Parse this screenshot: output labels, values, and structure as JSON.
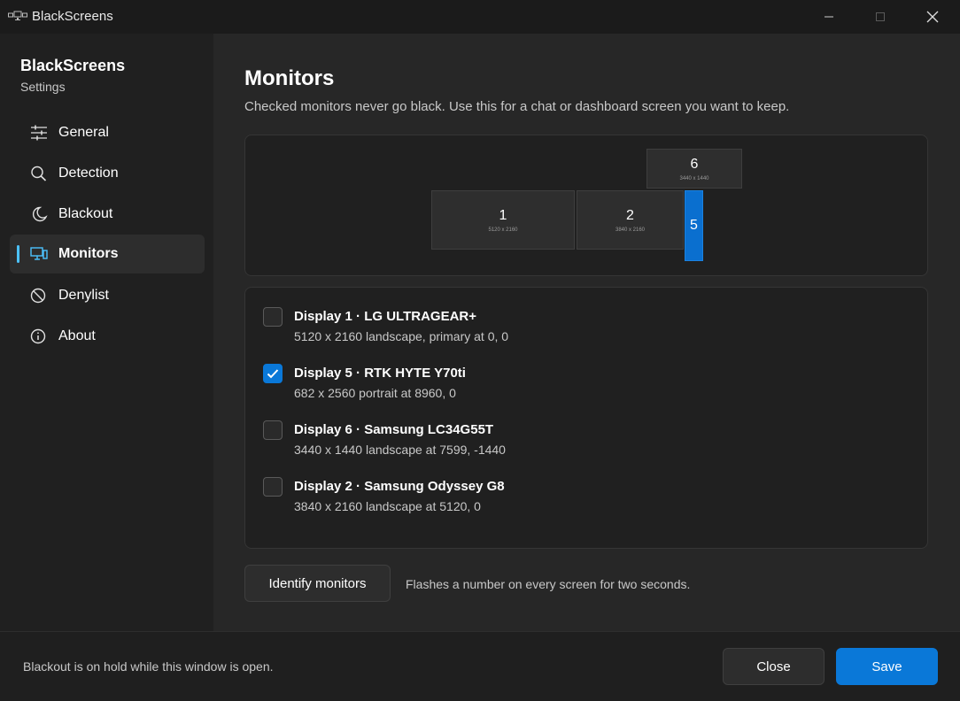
{
  "window": {
    "title": "BlackScreens"
  },
  "sidebar": {
    "brand_title": "BlackScreens",
    "brand_subtitle": "Settings",
    "items": [
      {
        "label": "General",
        "icon": "sliders-icon",
        "active": false
      },
      {
        "label": "Detection",
        "icon": "search-icon",
        "active": false
      },
      {
        "label": "Blackout",
        "icon": "moon-icon",
        "active": false
      },
      {
        "label": "Monitors",
        "icon": "monitor-icon",
        "active": true
      },
      {
        "label": "Denylist",
        "icon": "block-icon",
        "active": false
      },
      {
        "label": "About",
        "icon": "info-icon",
        "active": false
      }
    ]
  },
  "main": {
    "title": "Monitors",
    "description": "Checked monitors never go black. Use this for a chat or dashboard screen you want to keep.",
    "layout": {
      "monitors": [
        {
          "number": "1",
          "resolution": "5120 x 2160",
          "selected": false
        },
        {
          "number": "2",
          "resolution": "3840 x 2160",
          "selected": false
        },
        {
          "number": "6",
          "resolution": "3440 x 1440",
          "selected": false
        },
        {
          "number": "5",
          "resolution": "",
          "selected": true
        }
      ]
    },
    "displays": [
      {
        "title": "Display 1  ·  LG ULTRAGEAR+",
        "subtitle": "5120 x 2160 landscape, primary  at 0, 0",
        "checked": false
      },
      {
        "title": "Display 5  ·  RTK HYTE Y70ti",
        "subtitle": "682 x 2560 portrait  at 8960, 0",
        "checked": true
      },
      {
        "title": "Display 6  ·  Samsung LC34G55T",
        "subtitle": "3440 x 1440 landscape  at 7599, -1440",
        "checked": false
      },
      {
        "title": "Display 2  ·  Samsung Odyssey G8",
        "subtitle": "3840 x 2160 landscape  at 5120, 0",
        "checked": false
      }
    ],
    "identify_label": "Identify monitors",
    "identify_hint": "Flashes a number on every screen for two seconds."
  },
  "footer": {
    "message": "Blackout is on hold while this window is open.",
    "close_label": "Close",
    "save_label": "Save"
  },
  "colors": {
    "accent": "#0a78d8",
    "nav_indicator": "#4cc2ff"
  }
}
